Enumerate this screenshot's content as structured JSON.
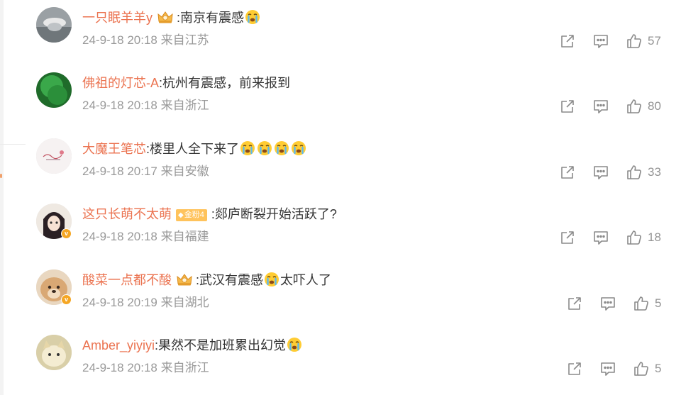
{
  "comments": [
    {
      "username": "一只眠羊羊y",
      "badge": "crown",
      "text": ":南京有震感",
      "emoji_after": 1,
      "text2": "",
      "emoji_after2": 0,
      "time": "24-9-18 20:18",
      "location": "来自江苏",
      "likes": "57",
      "avatar_color": "#8a8f94",
      "verified": false
    },
    {
      "username": "佛祖的灯芯-A",
      "badge": "none",
      "text": ":杭州有震感，前来报到",
      "emoji_after": 0,
      "text2": "",
      "emoji_after2": 0,
      "time": "24-9-18 20:18",
      "location": "来自浙江",
      "likes": "80",
      "avatar_color": "#2e8b3a",
      "verified": false
    },
    {
      "username": "大魔王笔芯",
      "badge": "none",
      "text": ":楼里人全下来了",
      "emoji_after": 4,
      "text2": "",
      "emoji_after2": 0,
      "time": "24-9-18 20:17",
      "location": "来自安徽",
      "likes": "33",
      "avatar_color": "#f2eeee",
      "verified": false
    },
    {
      "username": "这只长萌不太萌",
      "badge": "fans",
      "badge_label": "金粉4",
      "text": ":郯庐断裂开始活跃了?",
      "emoji_after": 0,
      "text2": "",
      "emoji_after2": 0,
      "time": "24-9-18 20:18",
      "location": "来自福建",
      "likes": "18",
      "avatar_color": "#e9e4de",
      "verified": true
    },
    {
      "username": "酸菜一点都不酸",
      "badge": "crown",
      "text": ":武汉有震感",
      "emoji_after": 1,
      "text2": "太吓人了",
      "emoji_after2": 0,
      "time": "24-9-18 20:19",
      "location": "来自湖北",
      "likes": "5",
      "avatar_color": "#d8b48c",
      "verified": true
    },
    {
      "username": "Amber_yiyiyi",
      "badge": "none",
      "text": ":果然不是加班累出幻觉",
      "emoji_after": 1,
      "text2": "",
      "emoji_after2": 0,
      "time": "24-9-18 20:18",
      "location": "来自浙江",
      "likes": "5",
      "avatar_color": "#e6d9b8",
      "verified": false
    }
  ],
  "colors": {
    "username": "#eb7350",
    "meta": "#999999",
    "icon": "#8a8a8a",
    "fans_badge": "#ffc35c"
  },
  "icons": {
    "share": "share-icon",
    "comment": "comment-icon",
    "like": "thumbs-up-icon"
  }
}
